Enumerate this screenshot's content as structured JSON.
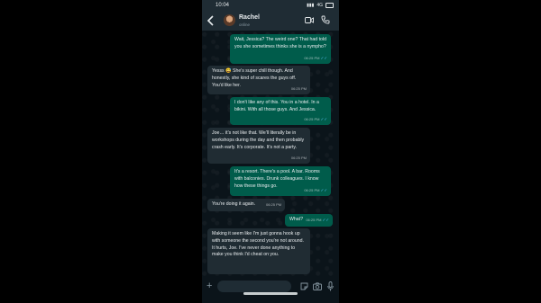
{
  "status_bar": {
    "time": "10:04",
    "network": "4G"
  },
  "header": {
    "contact_name": "Rachel",
    "contact_status": "online"
  },
  "messages": [
    {
      "direction": "out",
      "text": "Wait, Jessica? The weird one? That had told you she sometimes thinks she is a nympho?",
      "time": "06:25 PM",
      "read": true
    },
    {
      "direction": "in",
      "text": "Yesss 😅 She's super chill though. And honestly, she kind of scares the guys off. You'd like her.",
      "time": "06:25 PM"
    },
    {
      "direction": "out",
      "text": "I don't like any of this. You in a hotel. In a bikini. With all those guys. And Jessica.",
      "time": "06:25 PM",
      "read": true
    },
    {
      "direction": "in",
      "text": "Joe… it's not like that. We'll literally be in workshops during the day and then probably crash early. It's corporate. It's not a party.",
      "time": "06:25 PM"
    },
    {
      "direction": "out",
      "text": "It's a resort. There's a pool. A bar. Rooms with balconies. Drunk colleagues. I know how these things go.",
      "time": "06:25 PM",
      "read": true
    },
    {
      "direction": "in",
      "text": "You're doing it again.",
      "time": "06:25 PM"
    },
    {
      "direction": "out",
      "text": "What?",
      "time": "06:25 PM",
      "read": true
    },
    {
      "direction": "in",
      "text": "Making it seem like I'm just gonna hook up with someone the second you're not around. It hurts, Joe. I've never done anything to make you think I'd cheat on you.",
      "time": "06:25 PM"
    }
  ],
  "input": {
    "placeholder": "",
    "value": ""
  },
  "icons": {
    "back": "chevron-left-icon",
    "video": "video-call-icon",
    "call": "phone-icon",
    "plus": "plus-icon",
    "sticker": "sticker-icon",
    "camera": "camera-icon",
    "mic": "microphone-icon"
  },
  "colors": {
    "outgoing_bubble": "#005c4b",
    "incoming_bubble": "#202c33",
    "chat_background": "#0b141a",
    "header_background": "#1f2c34",
    "read_tick": "#53bdeb"
  }
}
